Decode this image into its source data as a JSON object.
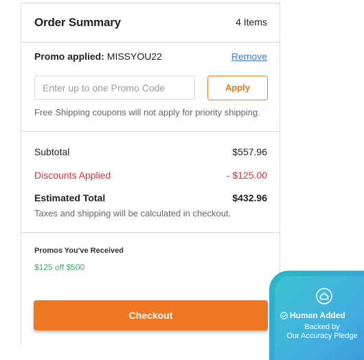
{
  "summary": {
    "title": "Order Summary",
    "item_count": "4 Items"
  },
  "promo": {
    "applied_label": "Promo applied:",
    "applied_code": "MISSYOU22",
    "remove_label": "Remove",
    "input_placeholder": "Enter up to one Promo Code",
    "input_value": "",
    "apply_label": "Apply",
    "note": "Free Shipping coupons will not apply for priority shipping."
  },
  "totals": {
    "subtotal_label": "Subtotal",
    "subtotal_value": "$557.96",
    "discounts_label": "Discounts Applied",
    "discounts_value": "- $125.00",
    "estimated_label": "Estimated Total",
    "estimated_value": "$432.96",
    "tax_note": "Taxes and shipping will be calculated in checkout."
  },
  "promos_received": {
    "title": "Promos You've Received",
    "items": [
      "$125 off $500"
    ]
  },
  "checkout": {
    "label": "Checkout"
  },
  "badge": {
    "icon": "shield-home-icon",
    "title": "Human Added",
    "line1": "Backed by",
    "line2": "Our Accuracy Pledge"
  },
  "colors": {
    "accent": "#ef7722",
    "discount_red": "#d6343f",
    "promo_green": "#3cae64",
    "link_blue": "#3a7bd5",
    "badge_teal": "#3cc3cf"
  }
}
